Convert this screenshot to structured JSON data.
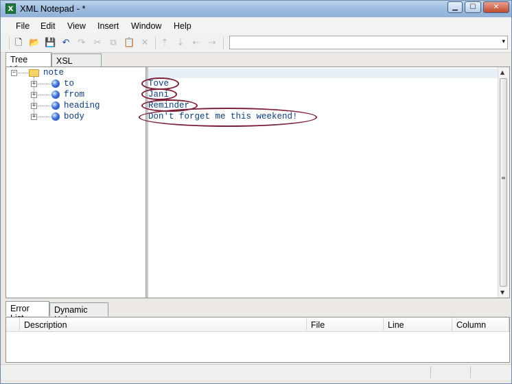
{
  "window": {
    "title": "XML Notepad - *",
    "app_icon": "X"
  },
  "window_buttons": {
    "minimize": "▁",
    "maximize": "☐",
    "close": "✕"
  },
  "menu": [
    "File",
    "Edit",
    "View",
    "Insert",
    "Window",
    "Help"
  ],
  "toolbar": {
    "new": "🗋",
    "open": "📂",
    "save": "💾",
    "undo": "↶",
    "redo": "↷",
    "cut": "✂",
    "copy": "⧉",
    "paste": "📋",
    "delete": "✕",
    "nudge_up": "⇡",
    "nudge_down": "⇣",
    "nudge_left": "⇠",
    "nudge_right": "⇢",
    "combo_value": "",
    "combo_arrow": "▾"
  },
  "tabs": [
    "Tree View",
    "XSL Output"
  ],
  "tree": {
    "root": {
      "expander": "−",
      "label": "note"
    },
    "children": [
      {
        "expander": "+",
        "label": "to",
        "value": "Tove"
      },
      {
        "expander": "+",
        "label": "from",
        "value": "Jani"
      },
      {
        "expander": "+",
        "label": "heading",
        "value": "Reminder"
      },
      {
        "expander": "+",
        "label": "body",
        "value": "Don't forget me this weekend!"
      }
    ]
  },
  "scrollbar": {
    "up": "▲",
    "down": "▼",
    "grip": "≡"
  },
  "bottom_tabs": [
    "Error List",
    "Dynamic Help"
  ],
  "error_list": {
    "columns": [
      "Description",
      "File",
      "Line",
      "Column"
    ]
  },
  "colors": {
    "title_gradient": "#9fbde0",
    "value_text": "#0b3d7a",
    "annotation_oval": "#7b1f3b"
  }
}
